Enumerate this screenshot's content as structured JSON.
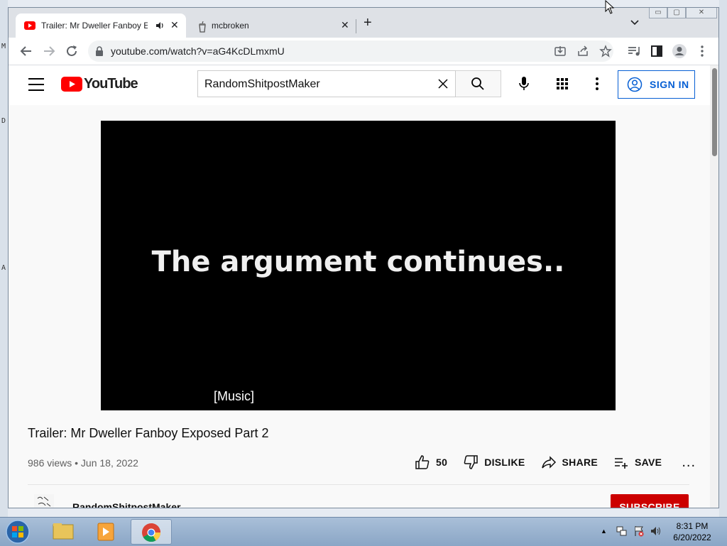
{
  "browser": {
    "tabs": [
      {
        "title": "Trailer: Mr Dweller Fanboy Exposed Part 2",
        "audio_icon": "speaker-icon",
        "active": true
      },
      {
        "title": "mcbroken",
        "active": false
      }
    ],
    "new_tab_symbol": "+",
    "url": "youtube.com/watch?v=aG4KcDLmxmU"
  },
  "youtube": {
    "logo_text": "YouTube",
    "search": {
      "value": "RandomShitpostMaker"
    },
    "signin_label": "SIGN IN",
    "video": {
      "overlay_text": "The argument continues..",
      "caption": "[Music]"
    },
    "title": "Trailer: Mr Dweller Fanboy Exposed Part 2",
    "meta": "986 views • Jun 18, 2022",
    "actions": {
      "like_count": "50",
      "dislike_label": "DISLIKE",
      "share_label": "SHARE",
      "save_label": "SAVE",
      "more": "..."
    },
    "channel": {
      "name": "RandomShitpostMaker"
    },
    "subscribe_label": "SUBSCRIBE"
  },
  "taskbar": {
    "clock_time": "8:31 PM",
    "clock_date": "6/20/2022"
  },
  "desktop_edge_chars": [
    "M",
    "D",
    "A"
  ],
  "colors": {
    "yt_red": "#ff0000",
    "signin_blue": "#065fd4",
    "subscribe_red": "#cc0000"
  }
}
